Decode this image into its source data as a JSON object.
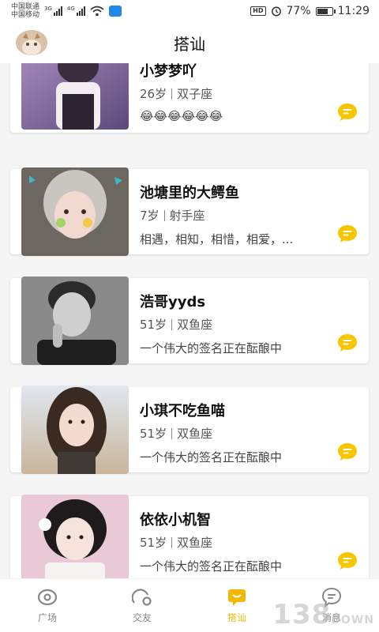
{
  "status_bar": {
    "carrier1": "中国联通",
    "carrier2": "中国移动",
    "net1": "3G",
    "net2": "4G",
    "hd": "HD",
    "battery": "77%",
    "battery_level": 0.77,
    "time": "11:29"
  },
  "header": {
    "title": "搭讪"
  },
  "users": [
    {
      "name": "小梦梦吖",
      "age": "26岁",
      "zodiac": "双子座",
      "sign": "😂😂😂😂😂😂"
    },
    {
      "name": "池塘里的大鳄鱼",
      "age": "7岁",
      "zodiac": "射手座",
      "sign": "相遇，相知，相惜，相爱，..."
    },
    {
      "name": "浩哥yyds",
      "age": "51岁",
      "zodiac": "双鱼座",
      "sign": "一个伟大的签名正在酝酿中"
    },
    {
      "name": "小琪不吃鱼喵",
      "age": "51岁",
      "zodiac": "双鱼座",
      "sign": "一个伟大的签名正在酝酿中"
    },
    {
      "name": "依依小机智",
      "age": "51岁",
      "zodiac": "双鱼座",
      "sign": "一个伟大的签名正在酝酿中"
    }
  ],
  "tabs": [
    {
      "label": "广场",
      "icon": "plaza-icon",
      "active": false
    },
    {
      "label": "交友",
      "icon": "friends-icon",
      "active": false
    },
    {
      "label": "搭讪",
      "icon": "chat-icon",
      "active": true
    },
    {
      "label": "消息",
      "icon": "message-icon",
      "active": false
    }
  ],
  "watermark": {
    "number": "138",
    "suffix": "DOWN"
  },
  "colors": {
    "accent": "#f5b800",
    "chat_button": "#f7c600"
  }
}
